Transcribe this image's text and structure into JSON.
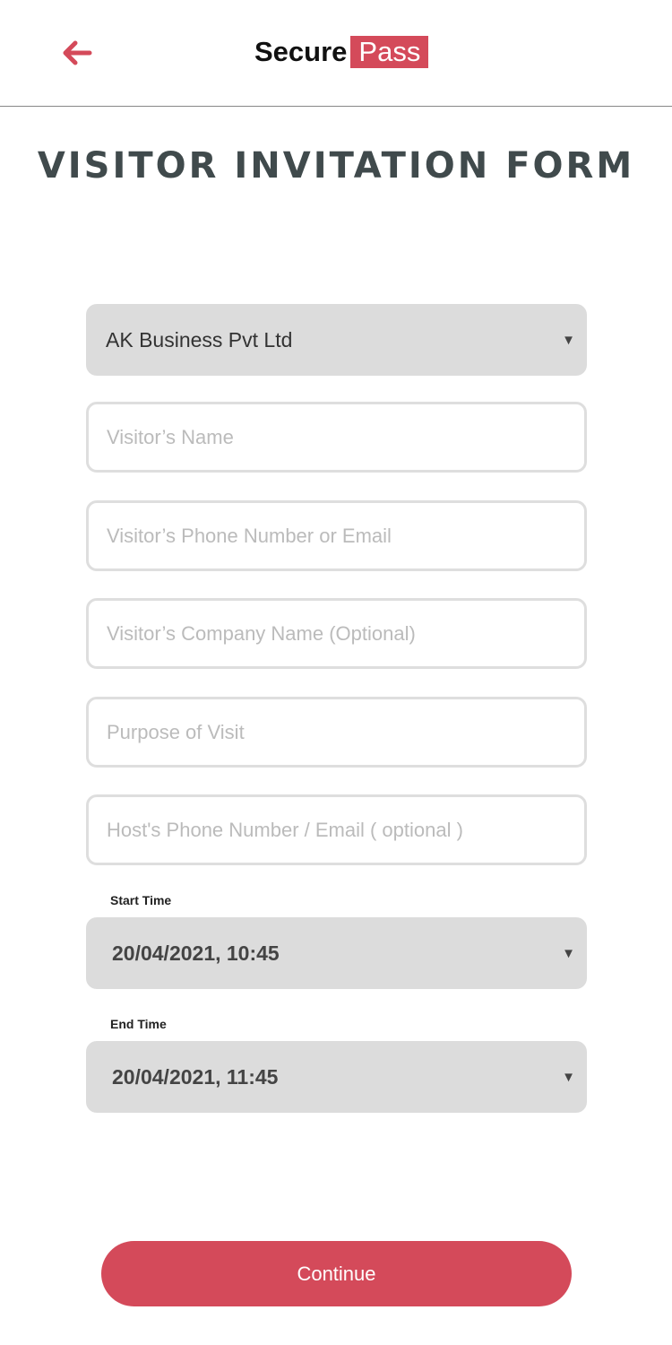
{
  "header": {
    "logo_part1": "Secure",
    "logo_part2": "Pass",
    "brand_color": "#d44a5a",
    "back_icon": "arrow-left-icon"
  },
  "title": "VISITOR INVITATION FORM",
  "form": {
    "company_select": "AK Business Pvt Ltd",
    "visitor_name_placeholder": "Visitor’s Name",
    "visitor_contact_placeholder": "Visitor’s Phone Number or Email",
    "visitor_company_placeholder": "Visitor’s Company Name (Optional)",
    "purpose_placeholder": "Purpose of Visit",
    "host_placeholder": "Host's Phone Number / Email ( optional )",
    "start_label": "Start Time",
    "start_value": "20/04/2021, 10:45",
    "end_label": "End Time",
    "end_value": "20/04/2021, 11:45",
    "caret": "▼"
  },
  "continue_label": "Continue"
}
